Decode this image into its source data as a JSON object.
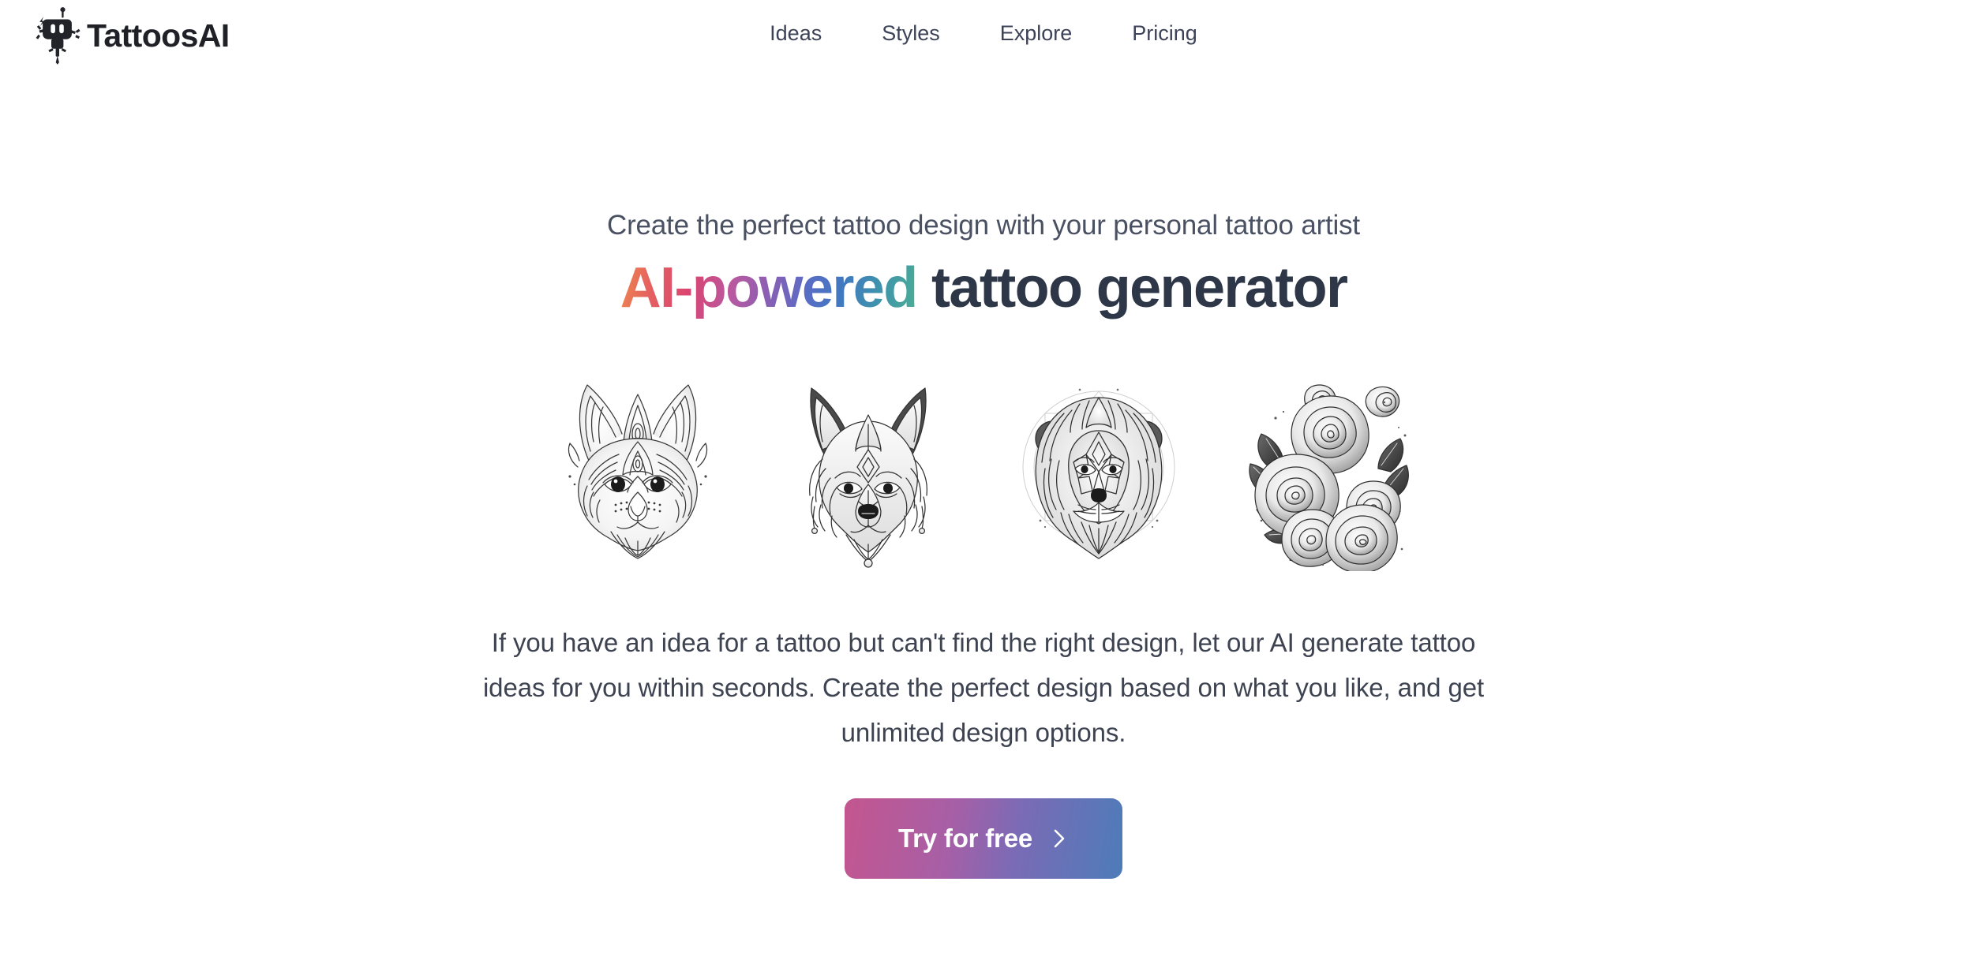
{
  "brand": {
    "name": "TattoosAI",
    "logo_icon": "tattoo-machine-robot-icon",
    "logo_color": "#222429"
  },
  "nav": {
    "items": [
      {
        "label": "Ideas"
      },
      {
        "label": "Styles"
      },
      {
        "label": "Explore"
      },
      {
        "label": "Pricing"
      }
    ],
    "link_color": "#3c4257"
  },
  "hero": {
    "eyebrow": "Create the perfect tattoo design with your personal tattoo artist",
    "title_gradient": "AI-powered",
    "title_space": " ",
    "title_plain": "tattoo generator",
    "title_gradient_colors": [
      "#ef8a4f",
      "#e5625f",
      "#da4470",
      "#b959a0",
      "#8a5fb4",
      "#5a6cc4",
      "#4079c0",
      "#3f93ac",
      "#4cae94"
    ],
    "title_plain_color": "#2d3748",
    "paragraph": "If you have an idea for a tattoo but can't find the right design, let our AI generate tattoo ideas for you within seconds. Create the perfect design based on what you like, and get unlimited design options."
  },
  "gallery": {
    "items": [
      {
        "alt": "Ornamental mandala cat head tattoo design",
        "icon": "cat-tattoo-icon"
      },
      {
        "alt": "Ornamental wolf head tattoo design",
        "icon": "wolf-tattoo-icon"
      },
      {
        "alt": "Geometric lion head tattoo design",
        "icon": "lion-tattoo-icon"
      },
      {
        "alt": "Rose bouquet tattoo design",
        "icon": "roses-tattoo-icon"
      }
    ]
  },
  "cta": {
    "label": "Try for free",
    "chevron_icon": "chevron-right-icon",
    "gradient_start": "#c4568f",
    "gradient_end": "#4d7cb8",
    "text_color": "#ffffff"
  },
  "page": {
    "background": "#ffffff"
  }
}
